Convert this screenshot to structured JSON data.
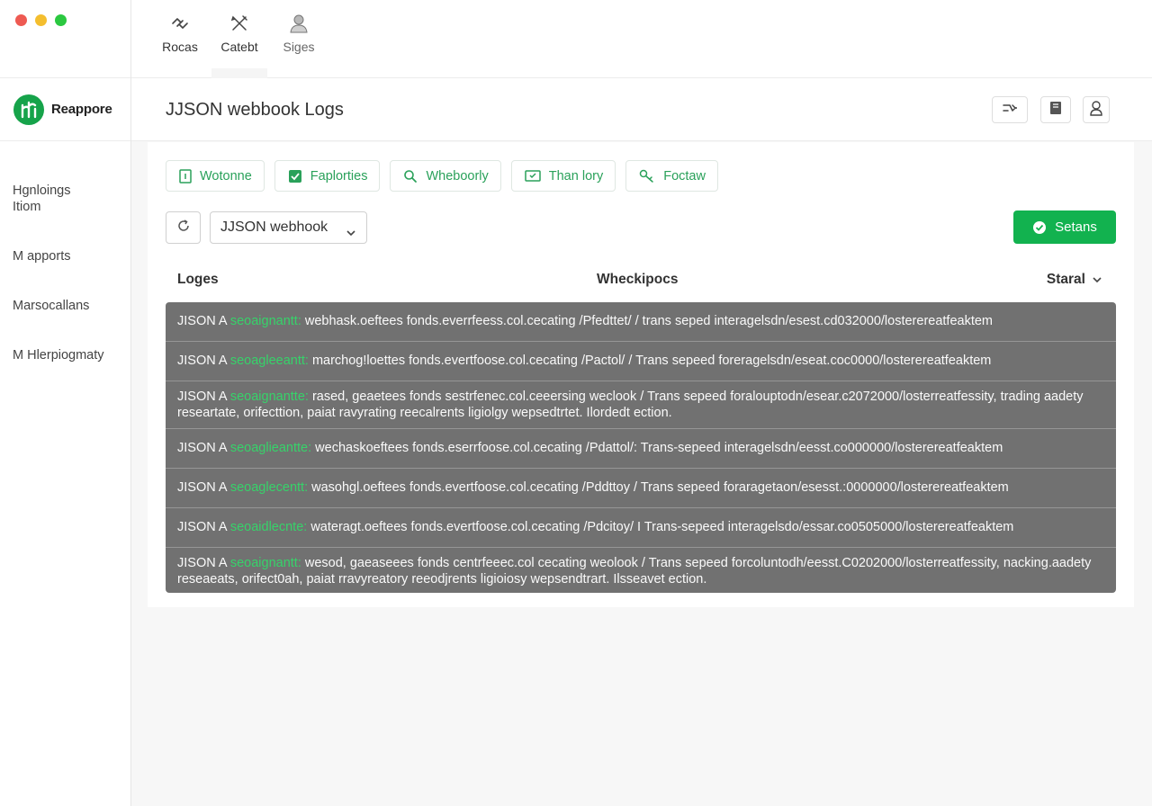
{
  "window": {
    "colors": {
      "close": "#ee5a52",
      "minimize": "#f4be2e",
      "zoom": "#2bc840"
    }
  },
  "top_tabs": [
    {
      "label": "Rocas",
      "icon": "link-icon"
    },
    {
      "label": "Catebt",
      "icon": "tools-icon"
    },
    {
      "label": "Siges",
      "icon": "user-icon"
    }
  ],
  "brand": {
    "name": "Reappore",
    "logo_color": "#16a34a"
  },
  "sidebar": {
    "items": [
      {
        "label": "Hgnloings Itiom"
      },
      {
        "label": "M apports"
      },
      {
        "label": "Marsocallans"
      },
      {
        "label": "M Hlerpiogmaty"
      }
    ]
  },
  "header": {
    "title": "JJSON webbook Logs"
  },
  "header_actions": [
    {
      "icon": "share-icon"
    },
    {
      "icon": "bookmark-icon"
    },
    {
      "icon": "account-icon"
    }
  ],
  "chips": [
    {
      "label": "Wotonne",
      "icon": "doc-icon"
    },
    {
      "label": "Faplorties",
      "icon": "check-square-icon"
    },
    {
      "label": "Wheboorly",
      "icon": "search-icon"
    },
    {
      "label": "Than lory",
      "icon": "monitor-icon"
    },
    {
      "label": "Foctaw",
      "icon": "key-icon"
    }
  ],
  "toolbar": {
    "refresh_icon": "refresh-icon",
    "select_value": "JJSON webhook",
    "primary_label": "Setans",
    "accent": "#12b24f"
  },
  "columns": {
    "logs": "Loges",
    "webhook": "Wheckipocs",
    "status": "Staral"
  },
  "logs": [
    {
      "prefix": "JISON A ",
      "highlight": "seoaignantt:",
      "text": " webhask.oeftees fonds.everrfeess.col.cecating /Pfedttet/ / trans seped interagelsdn/esest.cd032000/losterereatfeaktem"
    },
    {
      "prefix": "JISON A ",
      "highlight": "seoagleeantt:",
      "text": " marchog!loettes fonds.evertfoose.col.cecating /Pactol/ / Trans sepeed foreragelsdn/eseat.coc0000/losterereatfeaktem"
    },
    {
      "prefix": "JISON A ",
      "highlight": "seoaignantte:",
      "text": " rased, geaetees fonds sestrfenec.col.ceeersing weclook / Trans sepeed foralouptodn/esear.c2072000/losterreatfessity, trading aadety researtate, orifecttion, paiat ravyrating reecalrents ligiolgy wepsedtrtet. Ilordedt ection."
    },
    {
      "prefix": "JISON A ",
      "highlight": "seoaglieantte:",
      "text": " wechaskoeftees fonds.eserrfoose.col.cecating /Pdattol/: Trans-sepeed interagelsdn/eesst.co000000/losterereatfeaktem"
    },
    {
      "prefix": "JISON A ",
      "highlight": "seoaglecentt:",
      "text": " wasohgl.oeftees fonds.evertfoose.col.cecating /Pddttoy / Trans sepeed foraragetaon/esesst.:0000000/losterereatfeaktem"
    },
    {
      "prefix": "JISON A ",
      "highlight": "seoaidlecnte:",
      "text": " wateragt.oeftees fonds.evertfoose.col.cecating /Pdcitoy/ I Trans-sepeed interagelsdo/essar.co0505000/losterereatfeaktem"
    },
    {
      "prefix": "JISON A ",
      "highlight": "seoaignantt:",
      "text": " wesod, gaeaseees fonds centrfeeec.col cecating weolook / Trans sepeed forcoluntodh/eesst.C0202000/losterreatfessity, nacking.aadety reseaeats, orifect0ah, paiat rravyreatory reeodjrents ligioiosy wepsendtrart. Ilsseavet ection."
    }
  ]
}
